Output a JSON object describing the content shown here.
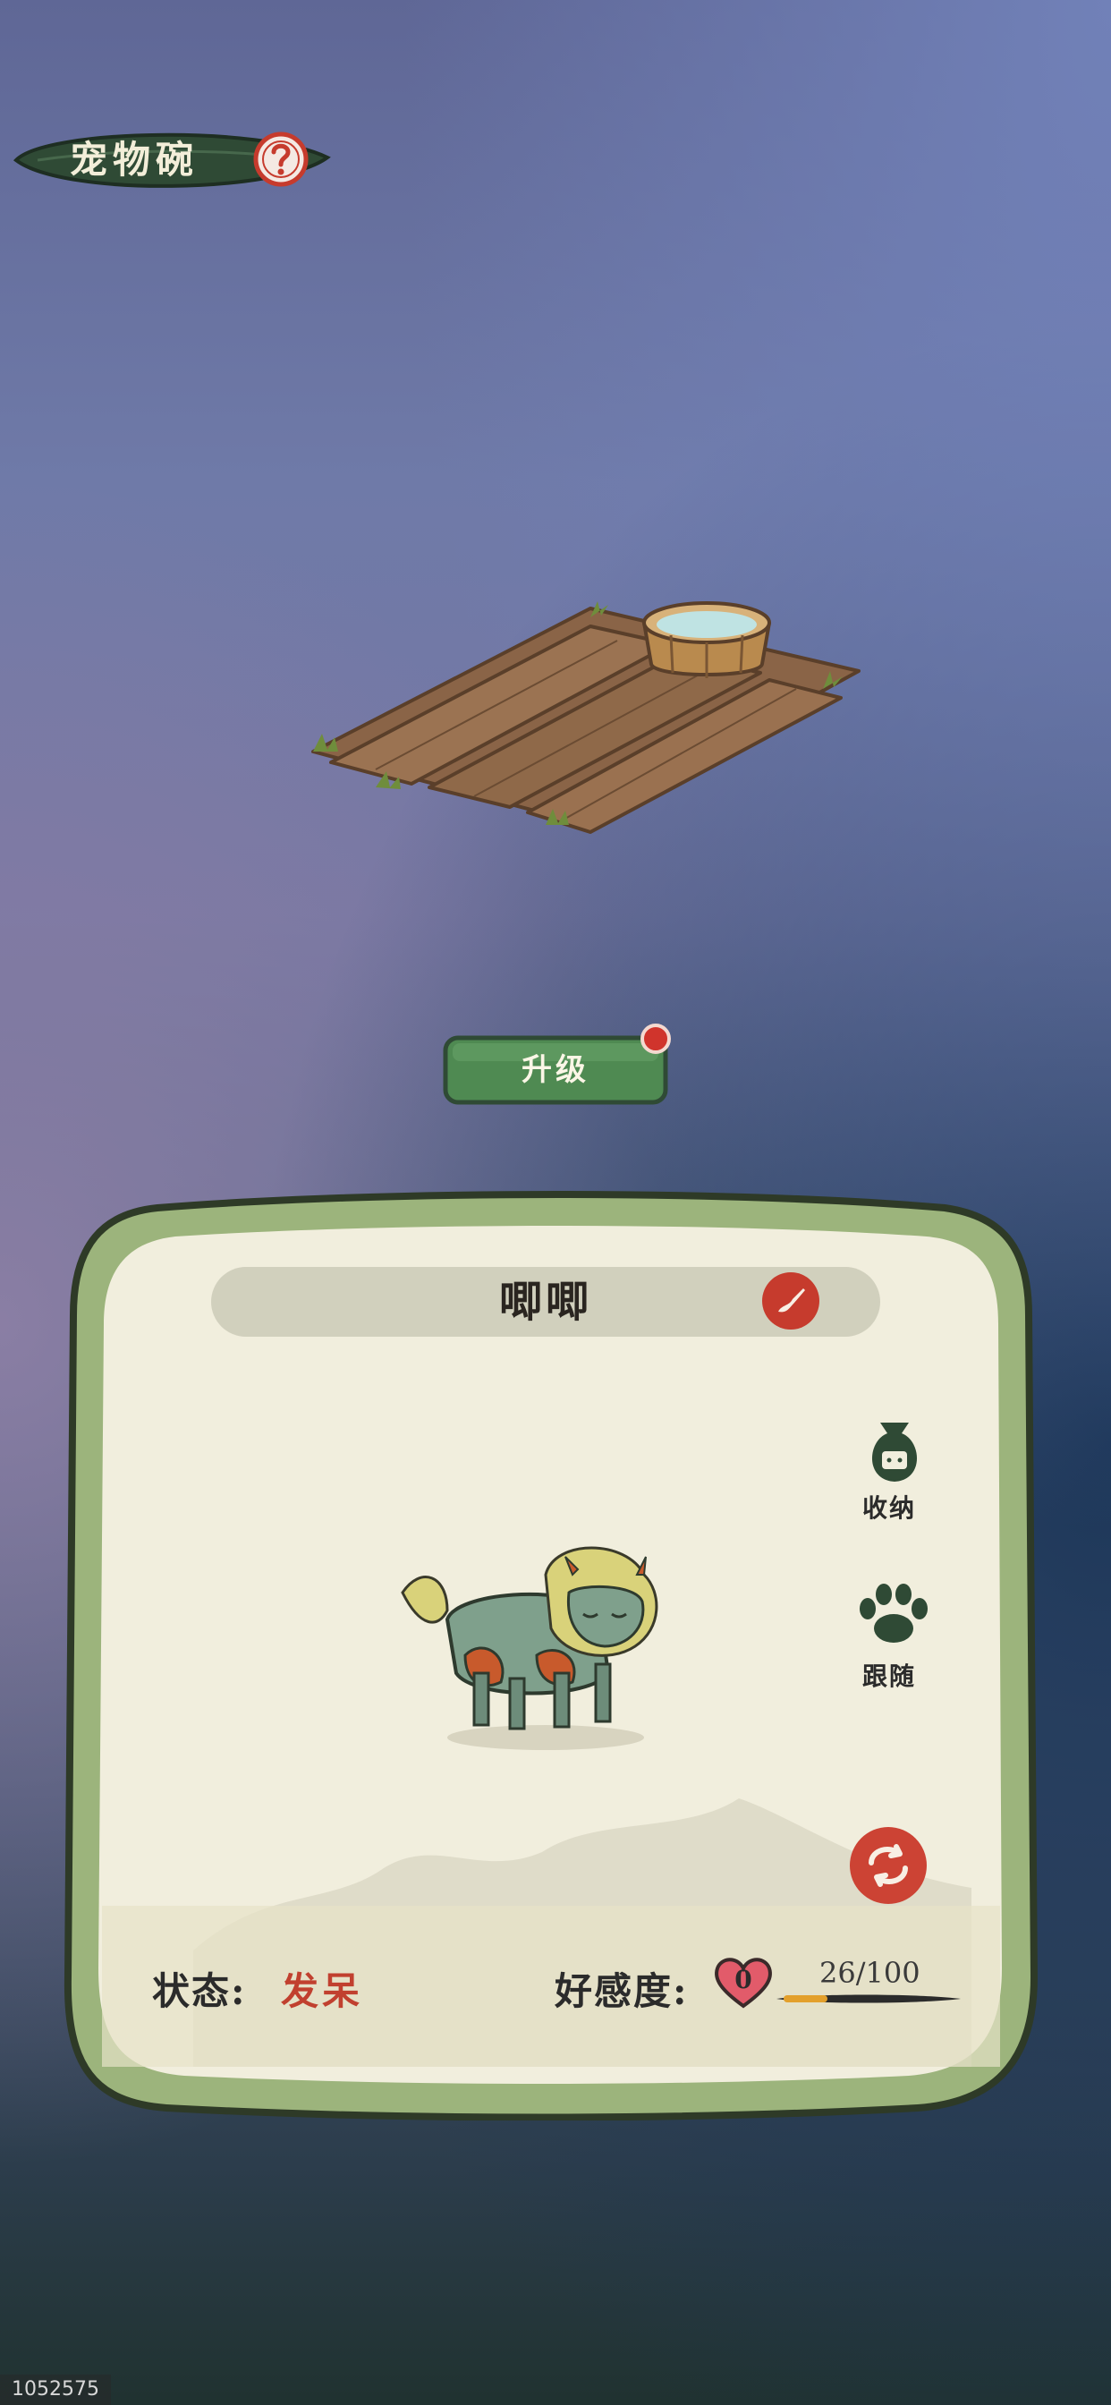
{
  "header": {
    "title": "宠物碗",
    "help_icon": "question-icon"
  },
  "upgrade": {
    "label": "升级",
    "has_notification": true
  },
  "pet": {
    "name": "唧唧",
    "rename_icon": "brush-icon",
    "actions": [
      {
        "label": "收纳",
        "icon": "storage-bag-icon"
      },
      {
        "label": "跟随",
        "icon": "paw-icon"
      }
    ],
    "refresh_icon": "refresh-icon",
    "status_label": "状态:",
    "status_value": "发呆",
    "affection_label": "好感度:",
    "affection_level": "0",
    "affection_current": 26,
    "affection_max": 100,
    "affection_text": "26/100"
  },
  "footer": {
    "build_id": "1052575"
  },
  "colors": {
    "accent_green": "#4f8a52",
    "accent_red": "#c63b2d",
    "bar_fill": "#e3a02c"
  }
}
